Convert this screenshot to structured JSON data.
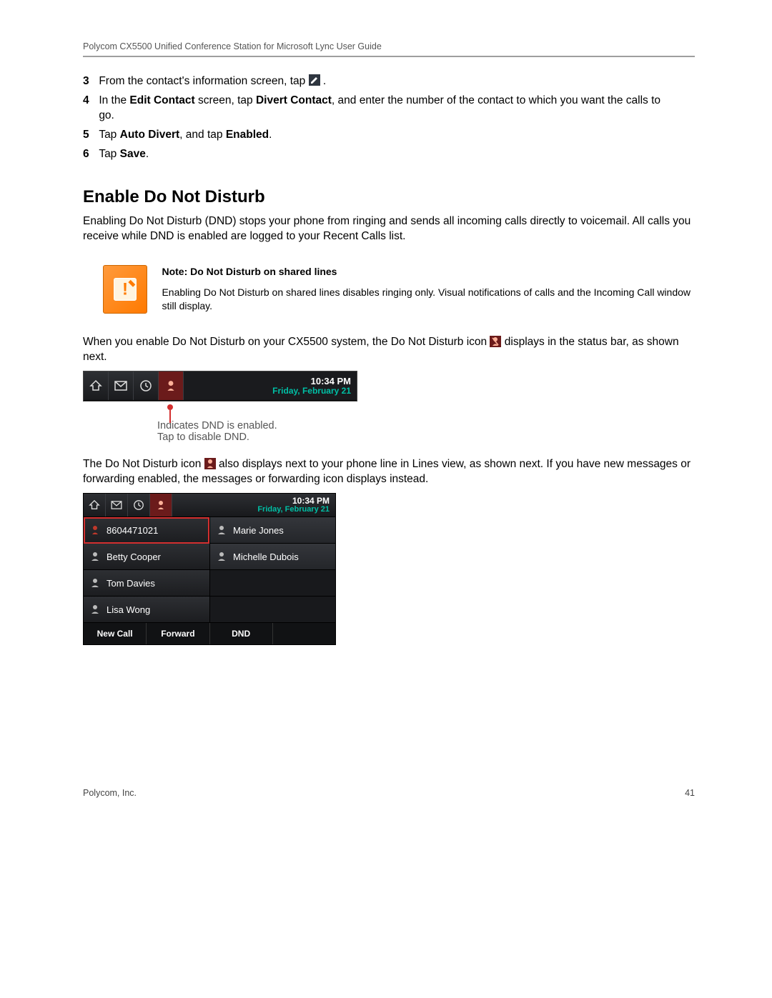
{
  "header": "Polycom CX5500 Unified Conference Station for Microsoft Lync User Guide",
  "steps": {
    "s3_num": "3",
    "s3_a": "From the contact's information screen, tap ",
    "s3_b": " .",
    "s4_num": "4",
    "s4_a": "In the ",
    "s4_b": "Edit Contact",
    "s4_c": " screen, tap ",
    "s4_d": "Divert Contact",
    "s4_e": ", and enter the number of the contact to which you want the calls to go.",
    "s5_num": "5",
    "s5_a": "Tap ",
    "s5_b": "Auto Divert",
    "s5_c": ", and tap ",
    "s5_d": "Enabled",
    "s5_e": ".",
    "s6_num": "6",
    "s6_a": "Tap ",
    "s6_b": "Save",
    "s6_c": "."
  },
  "section_title": "Enable Do Not Disturb",
  "para1": "Enabling Do Not Disturb (DND) stops your phone from ringing and sends all incoming calls directly to voicemail. All calls you receive while DND is enabled are logged to your Recent Calls list.",
  "note": {
    "title": "Note: Do Not Disturb on shared lines",
    "body": "Enabling Do Not Disturb on shared lines disables ringing only. Visual notifications of calls and the Incoming Call window still display."
  },
  "para2_a": "When you enable Do Not Disturb on your CX5500 system, the Do Not Disturb icon ",
  "para2_b": " displays in the status bar, as shown next.",
  "statusbar1": {
    "time": "10:34 PM",
    "date": "Friday, February 21"
  },
  "callout1": "Indicates DND is enabled.",
  "callout2": "Tap to disable DND.",
  "para3_a": "The Do Not Disturb icon ",
  "para3_b": " also displays next to your phone line in Lines view, as shown next. If you have new messages or forwarding enabled, the messages or forwarding icon displays instead.",
  "linesview": {
    "time": "10:34 PM",
    "date": "Friday, February 21",
    "left": [
      "8604471021",
      "Betty Cooper",
      "Tom Davies",
      "Lisa Wong"
    ],
    "right": [
      "Marie Jones",
      "Michelle Dubois"
    ],
    "softkeys": [
      "New Call",
      "Forward",
      "DND"
    ]
  },
  "footer_left": "Polycom, Inc.",
  "footer_right": "41"
}
